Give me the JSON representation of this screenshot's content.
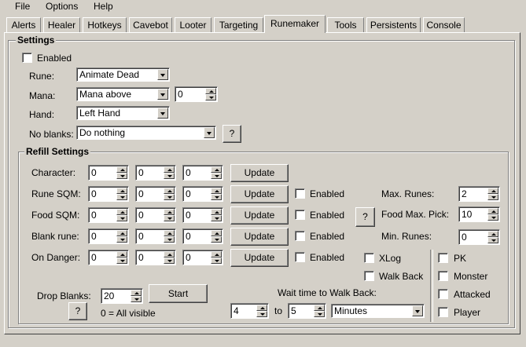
{
  "menu": [
    "File",
    "Options",
    "Help"
  ],
  "tabs": [
    "Alerts",
    "Healer",
    "Hotkeys",
    "Cavebot",
    "Looter",
    "Targeting",
    "Runemaker",
    "Tools",
    "Persistents",
    "Console"
  ],
  "active_tab": "Runemaker",
  "settings": {
    "title": "Settings",
    "enabled_label": "Enabled",
    "rune_label": "Rune:",
    "rune_value": "Animate Dead",
    "mana_label": "Mana:",
    "mana_value": "Mana above",
    "mana_amount": "0",
    "hand_label": "Hand:",
    "hand_value": "Left Hand",
    "no_blanks_label": "No blanks:",
    "no_blanks_value": "Do nothing",
    "help_label": "?"
  },
  "refill": {
    "title": "Refill Settings",
    "update_label": "Update",
    "enabled_label": "Enabled",
    "rows": [
      {
        "label": "Character:",
        "v1": "0",
        "v2": "0",
        "v3": "0"
      },
      {
        "label": "Rune SQM:",
        "v1": "0",
        "v2": "0",
        "v3": "0"
      },
      {
        "label": "Food SQM:",
        "v1": "0",
        "v2": "0",
        "v3": "0"
      },
      {
        "label": "Blank rune:",
        "v1": "0",
        "v2": "0",
        "v3": "0"
      },
      {
        "label": "On Danger:",
        "v1": "0",
        "v2": "0",
        "v3": "0"
      }
    ],
    "help_label": "?",
    "max_runes_label": "Max. Runes:",
    "max_runes_value": "2",
    "food_max_pick_label": "Food Max. Pick:",
    "food_max_pick_value": "10",
    "min_runes_label": "Min. Runes:",
    "min_runes_value": "0",
    "xlog_label": "XLog",
    "walk_back_label": "Walk Back",
    "pk_label": "PK",
    "monster_label": "Monster",
    "attacked_label": "Attacked",
    "player_label": "Player",
    "drop_blanks_label": "Drop Blanks:",
    "drop_blanks_value": "20",
    "start_label": "Start",
    "all_visible_label": "0 = All visible",
    "wait_label": "Wait time to Walk Back:",
    "wait_from": "4",
    "to_label": "to",
    "wait_to": "5",
    "wait_unit": "Minutes"
  }
}
